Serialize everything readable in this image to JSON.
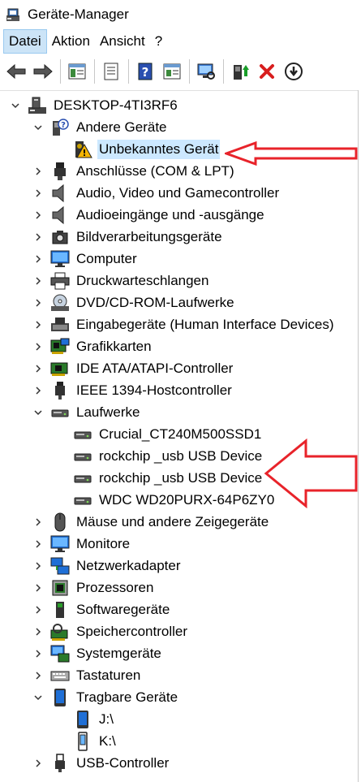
{
  "window": {
    "title": "Geräte-Manager",
    "app_icon": "device-manager-icon"
  },
  "menu": [
    {
      "label": "Datei",
      "active": true
    },
    {
      "label": "Aktion",
      "active": false
    },
    {
      "label": "Ansicht",
      "active": false
    },
    {
      "label": "?",
      "active": false
    }
  ],
  "toolbar": [
    "back-arrow-icon",
    "forward-arrow-icon",
    "properties-pane-icon",
    "properties-icon",
    "help-icon",
    "show-hidden-icon",
    "scan-hardware-icon",
    "update-driver-icon",
    "uninstall-icon",
    "disable-device-icon"
  ],
  "tree": {
    "root": "DESKTOP-4TI3RF6",
    "categories": [
      {
        "label": "Andere Geräte",
        "icon": "unknown-device-icon",
        "expanded": true,
        "children": [
          {
            "label": "Unbekanntes Gerät",
            "icon": "warning-device-icon",
            "selected": true
          }
        ]
      },
      {
        "label": "Anschlüsse (COM & LPT)",
        "icon": "port-icon"
      },
      {
        "label": "Audio, Video und Gamecontroller",
        "icon": "speaker-icon"
      },
      {
        "label": "Audioeingänge und -ausgänge",
        "icon": "speaker-icon"
      },
      {
        "label": "Bildverarbeitungsgeräte",
        "icon": "camera-icon"
      },
      {
        "label": "Computer",
        "icon": "monitor-icon"
      },
      {
        "label": "Druckwarteschlangen",
        "icon": "printer-icon"
      },
      {
        "label": "DVD/CD-ROM-Laufwerke",
        "icon": "dvd-drive-icon"
      },
      {
        "label": "Eingabegeräte (Human Interface Devices)",
        "icon": "hid-icon"
      },
      {
        "label": "Grafikkarten",
        "icon": "graphics-card-icon"
      },
      {
        "label": "IDE ATA/ATAPI-Controller",
        "icon": "ide-controller-icon"
      },
      {
        "label": "IEEE 1394-Hostcontroller",
        "icon": "firewire-icon"
      },
      {
        "label": "Laufwerke",
        "icon": "disk-drive-icon",
        "expanded": true,
        "children": [
          {
            "label": "Crucial_CT240M500SSD1",
            "icon": "disk-drive-icon"
          },
          {
            "label": "rockchip _usb USB Device",
            "icon": "disk-drive-icon"
          },
          {
            "label": "rockchip _usb USB Device",
            "icon": "disk-drive-icon"
          },
          {
            "label": "WDC WD20PURX-64P6ZY0",
            "icon": "disk-drive-icon"
          }
        ]
      },
      {
        "label": "Mäuse und andere Zeigegeräte",
        "icon": "mouse-icon"
      },
      {
        "label": "Monitore",
        "icon": "monitor-icon"
      },
      {
        "label": "Netzwerkadapter",
        "icon": "network-adapter-icon"
      },
      {
        "label": "Prozessoren",
        "icon": "processor-icon"
      },
      {
        "label": "Softwaregeräte",
        "icon": "software-device-icon"
      },
      {
        "label": "Speichercontroller",
        "icon": "storage-controller-icon"
      },
      {
        "label": "Systemgeräte",
        "icon": "system-device-icon"
      },
      {
        "label": "Tastaturen",
        "icon": "keyboard-icon"
      },
      {
        "label": "Tragbare Geräte",
        "icon": "portable-device-icon",
        "expanded": true,
        "children": [
          {
            "label": "J:\\",
            "icon": "portable-device-icon"
          },
          {
            "label": "K:\\",
            "icon": "portable-storage-icon"
          }
        ]
      },
      {
        "label": "USB-Controller",
        "icon": "usb-icon"
      }
    ]
  },
  "colors": {
    "selection": "#cce8ff",
    "menu_active": "#cce4f7",
    "annotation_arrow": "#e8232a"
  }
}
